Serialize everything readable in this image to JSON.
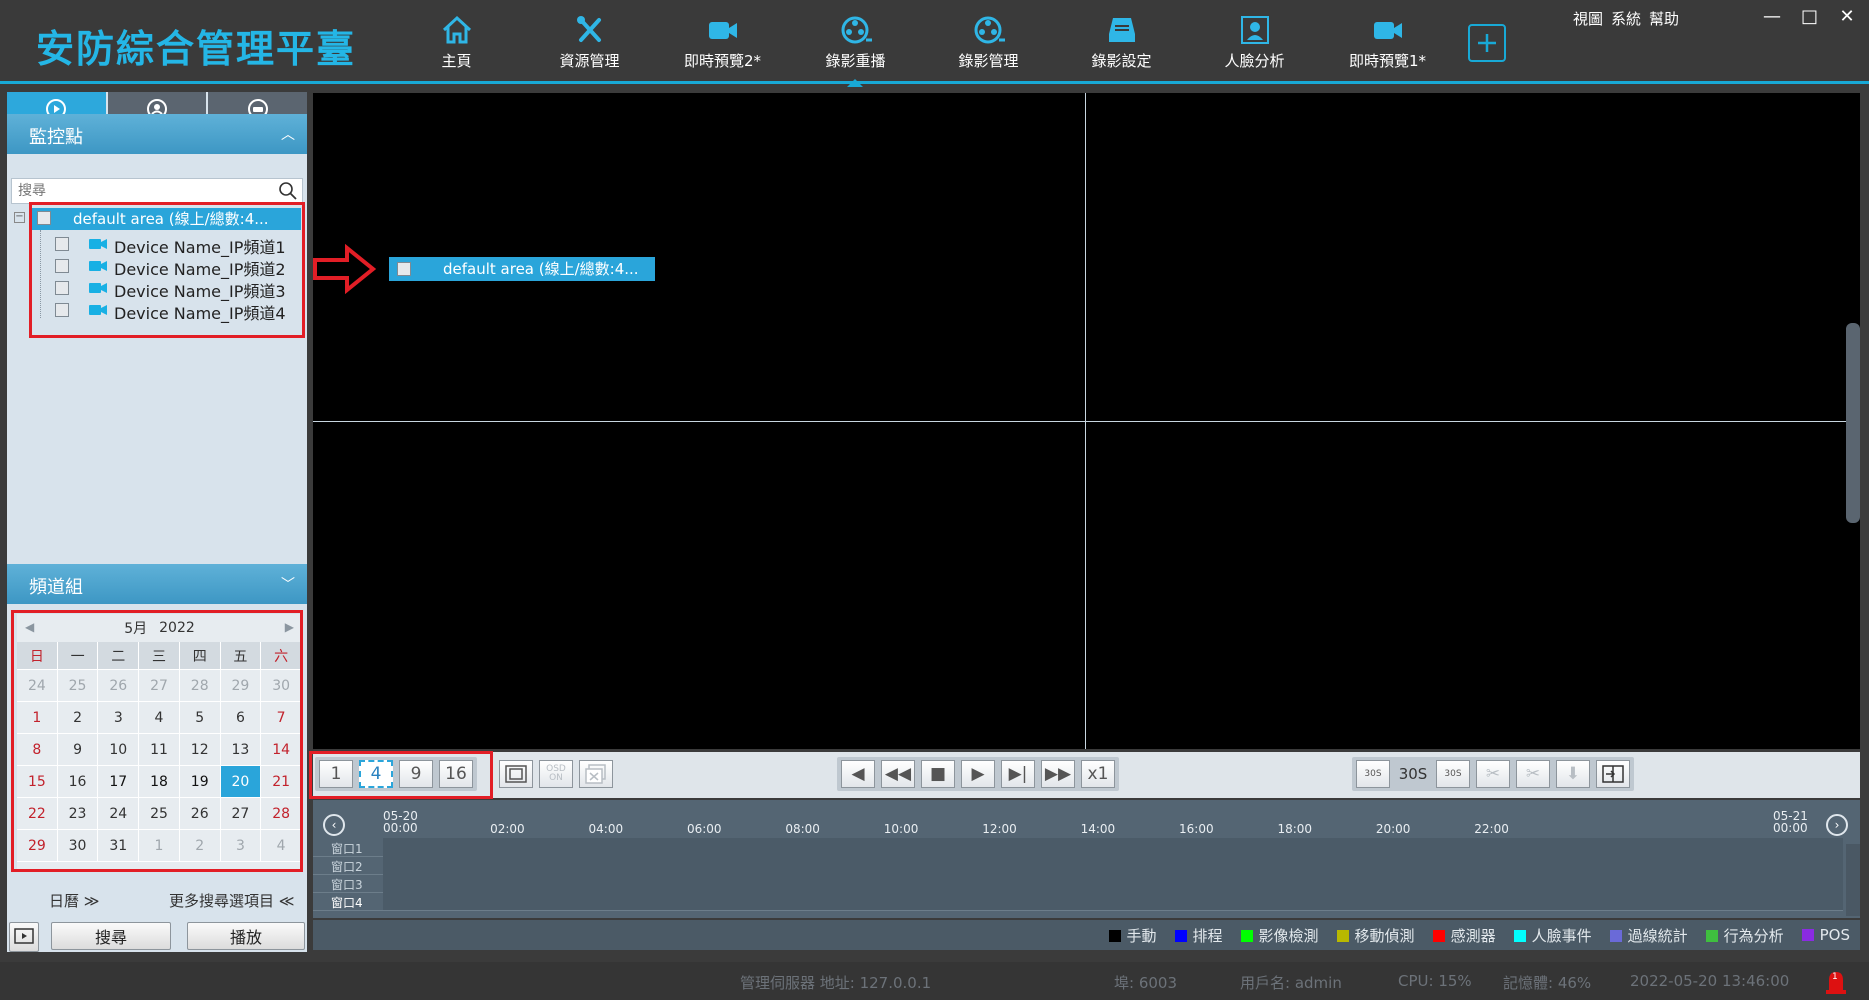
{
  "app": {
    "title": "安防綜合管理平臺"
  },
  "nav": {
    "items": [
      {
        "label": "主頁",
        "icon": "home-icon"
      },
      {
        "label": "資源管理",
        "icon": "tools-icon"
      },
      {
        "label": "即時預覽2*",
        "icon": "video-camera-icon"
      },
      {
        "label": "錄影重播",
        "icon": "film-reel-icon",
        "active": true
      },
      {
        "label": "錄影管理",
        "icon": "film-reel-icon"
      },
      {
        "label": "錄影設定",
        "icon": "storage-icon"
      },
      {
        "label": "人臉分析",
        "icon": "face-frame-icon"
      },
      {
        "label": "即時預覽1*",
        "icon": "video-camera-icon"
      }
    ]
  },
  "top_menu": {
    "view": "視圖",
    "system": "系統",
    "help": "幫助"
  },
  "window_controls": {
    "minimize": "—",
    "maximize": "□",
    "close": "✕"
  },
  "left": {
    "tabs": [
      "playback-icon",
      "person-search-icon",
      "vehicle-search-icon"
    ],
    "monitor_header": "監控點",
    "search_placeholder": "搜尋",
    "tree": {
      "root": "default area (線上/總數:4...",
      "items": [
        "Device Name_IP頻道1",
        "Device Name_IP頻道2",
        "Device Name_IP頻道3",
        "Device Name_IP頻道4"
      ]
    },
    "channel_group_header": "頻道組",
    "calendar": {
      "month_label": "5月",
      "year": "2022",
      "weekdays": [
        "日",
        "一",
        "二",
        "三",
        "四",
        "五",
        "六"
      ],
      "days": [
        [
          "24",
          "25",
          "26",
          "27",
          "28",
          "29",
          "30"
        ],
        [
          "1",
          "2",
          "3",
          "4",
          "5",
          "6",
          "7"
        ],
        [
          "8",
          "9",
          "10",
          "11",
          "12",
          "13",
          "14"
        ],
        [
          "15",
          "16",
          "17",
          "18",
          "19",
          "20",
          "21"
        ],
        [
          "22",
          "23",
          "24",
          "25",
          "26",
          "27",
          "28"
        ],
        [
          "29",
          "30",
          "31",
          "1",
          "2",
          "3",
          "4"
        ]
      ],
      "selected": "20"
    },
    "calendar_toggle": "日曆",
    "more_options": "更多搜尋選項目",
    "search_button": "搜尋",
    "play_button": "播放"
  },
  "video": {
    "drag_label": "default area (線上/總數:4..."
  },
  "controls": {
    "layouts": [
      "1",
      "4",
      "9",
      "16"
    ],
    "selected_layout": "4",
    "osd_label": "OSD ON",
    "speed_label": "x1",
    "skip_label": "30S",
    "skip_back": "30S",
    "skip_forward": "30S"
  },
  "timeline": {
    "start_label": {
      "date": "05-20",
      "time": "00:00"
    },
    "end_label": {
      "date": "05-21",
      "time": "00:00"
    },
    "ticks": [
      "02:00",
      "04:00",
      "06:00",
      "08:00",
      "10:00",
      "12:00",
      "14:00",
      "16:00",
      "18:00",
      "20:00",
      "22:00"
    ],
    "rows": [
      "窗口1",
      "窗口2",
      "窗口3",
      "窗口4"
    ]
  },
  "legend": [
    {
      "label": "手動",
      "color": "#000000"
    },
    {
      "label": "排程",
      "color": "#0000ff"
    },
    {
      "label": "影像檢測",
      "color": "#00ff00"
    },
    {
      "label": "移動偵測",
      "color": "#b8b800"
    },
    {
      "label": "感測器",
      "color": "#ff0000"
    },
    {
      "label": "人臉事件",
      "color": "#00ffff"
    },
    {
      "label": "過線統計",
      "color": "#6a6ad8"
    },
    {
      "label": "行為分析",
      "color": "#3fbf3f"
    },
    {
      "label": "POS",
      "color": "#8a2be2"
    }
  ],
  "status": {
    "server": "管理伺服器 地址: 127.0.0.1",
    "port": "埠: 6003",
    "user": "用戶名: admin",
    "cpu": "CPU: 15%",
    "memory": "記憶體: 46%",
    "datetime": "2022-05-20 13:46:00",
    "alarm_count": "1"
  },
  "colors": {
    "accent": "#18a9d6",
    "highlight_box": "#e21e26",
    "selected_blue": "#2aa5da"
  }
}
